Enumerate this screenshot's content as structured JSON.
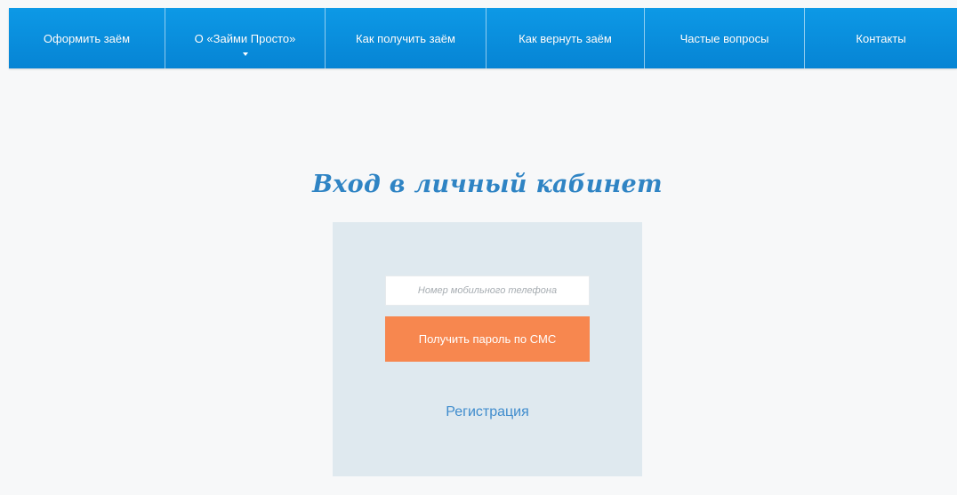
{
  "nav": {
    "items": [
      {
        "label": "Оформить заём"
      },
      {
        "label": "О «Займи Просто»",
        "has_dropdown": true
      },
      {
        "label": "Как получить заём"
      },
      {
        "label": "Как вернуть заём"
      },
      {
        "label": "Частые вопросы"
      },
      {
        "label": "Контакты"
      }
    ]
  },
  "login": {
    "title": "Вход в личный кабинет",
    "phone_placeholder": "Номер мобильного телефона",
    "phone_value": "",
    "sms_button_label": "Получить пароль по СМС",
    "register_link": "Регистрация"
  },
  "colors": {
    "nav_background": "#0a8fdd",
    "title": "#2f84c4",
    "panel": "#dfe9ef",
    "button": "#f7874f",
    "link": "#3f8ccd",
    "page_background": "#f7f8f9"
  },
  "icons": {
    "dropdown": "chevron-down-icon"
  }
}
